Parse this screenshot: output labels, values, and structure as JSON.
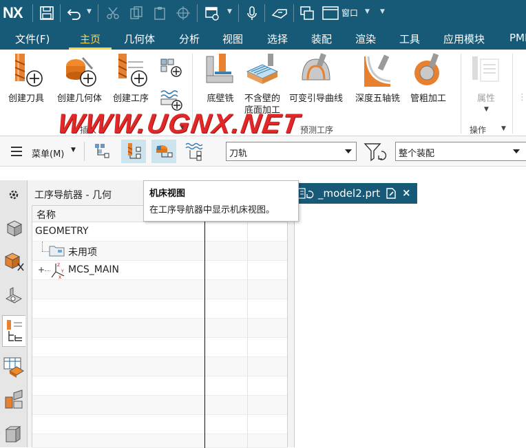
{
  "app": {
    "logo": "NX",
    "window_menu": "窗口"
  },
  "menubar": {
    "items": [
      "文件(F)",
      "主页",
      "几何体",
      "分析",
      "视图",
      "选择",
      "装配",
      "渲染",
      "工具",
      "应用模块",
      "PMI"
    ],
    "active_index": 1
  },
  "ribbon": {
    "insert_buttons": [
      "创建刀具",
      "创建几何体",
      "创建工序"
    ],
    "ops_buttons": [
      "底壁铣",
      "不含壁的\n底面加工",
      "可变引导曲线",
      "深度五轴铣",
      "管粗加工"
    ],
    "actions_buttons": [
      "属性"
    ],
    "groups": {
      "insert": "插入",
      "predict": "预测工序",
      "actions": "操作"
    }
  },
  "watermark": "WWW.UGNX.NET",
  "quickbar": {
    "menu_label": "菜单(M)",
    "toolpath_value": "刀轨",
    "scope_value": "整个装配"
  },
  "tooltip": {
    "title": "机床视图",
    "body": "在工序导航器中显示机床视图。"
  },
  "navigator": {
    "title": "工序导航器 - 几何",
    "column_name": "名称",
    "rows": [
      {
        "label": "GEOMETRY"
      },
      {
        "label": "未用项"
      },
      {
        "label": "MCS_MAIN"
      }
    ]
  },
  "document": {
    "tab_name": "_model2.prt"
  },
  "colors": {
    "titlebar": "#175a78",
    "accent": "#ffd24d",
    "watermark": "#e02828",
    "active_button": "#cde3ee"
  }
}
